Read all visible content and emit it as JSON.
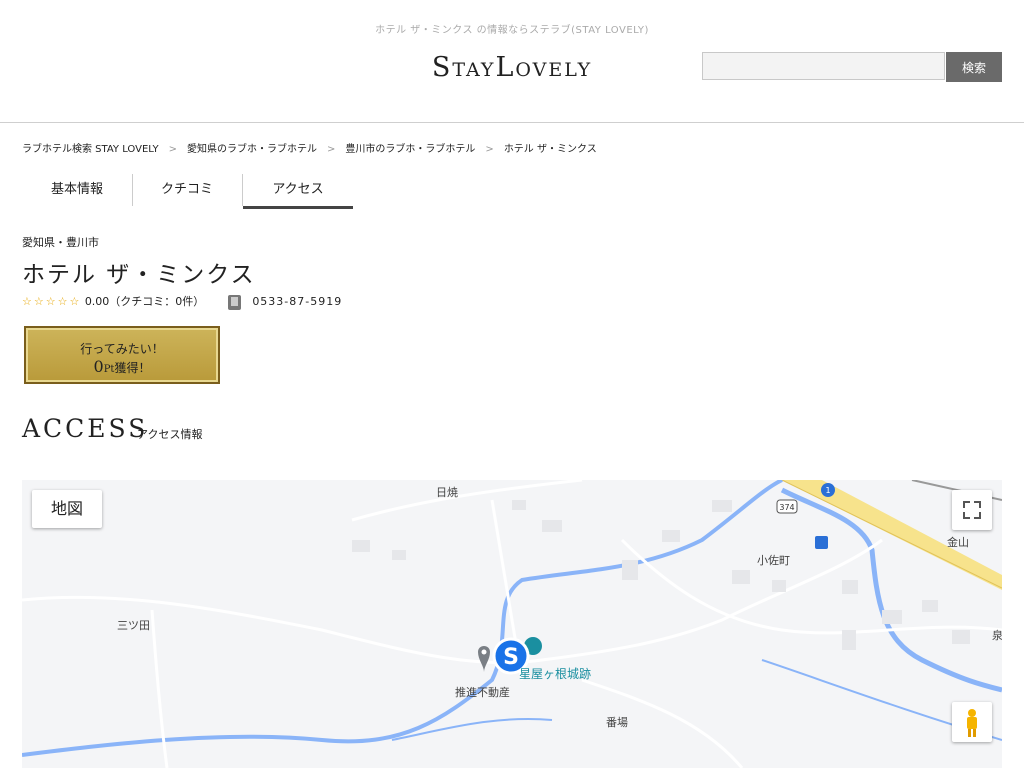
{
  "header": {
    "tagline": "ホテル ザ・ミンクス の情報ならステラブ(STAY LOVELY)",
    "logo": "StayLovely",
    "search": {
      "value": "",
      "placeholder": "",
      "button_label": "検索"
    }
  },
  "breadcrumb": [
    "ラブホテル検索 STAY LOVELY",
    "愛知県のラブホ・ラブホテル",
    "豊川市のラブホ・ラブホテル",
    "ホテル ザ・ミンクス"
  ],
  "breadcrumb_sep": ">",
  "tabs": [
    {
      "label": "基本情報",
      "active": false
    },
    {
      "label": "クチコミ",
      "active": false
    },
    {
      "label": "アクセス",
      "active": true
    }
  ],
  "hotel": {
    "prefecture_city": "愛知県・豊川市",
    "name": "ホテル ザ・ミンクス",
    "stars": "☆☆☆☆☆",
    "rating_text": "0.00（クチコミ：0件）",
    "phone": "0533-87-5919"
  },
  "want_button": {
    "line1": "行ってみたい！",
    "points": "0",
    "points_unit": "Pt",
    "line2_suffix": "獲得！"
  },
  "access": {
    "title": "ACCESS",
    "subtitle": "アクセス情報"
  },
  "map": {
    "type_button": "地図",
    "labels": {
      "hikiyaki": "日焼",
      "mitsuda": "三ツ田",
      "kosacho": "小佐町",
      "kanayama": "金山",
      "banba": "番場",
      "suishin": "推進不動産",
      "poi": "星屋ヶ根城跡",
      "route374": "374",
      "route1": "1",
      "edge": "泉"
    },
    "colors": {
      "water": "#8ab4f8",
      "highway": "#f7e38c",
      "road": "#ffffff",
      "bg": "#f4f5f7"
    }
  }
}
